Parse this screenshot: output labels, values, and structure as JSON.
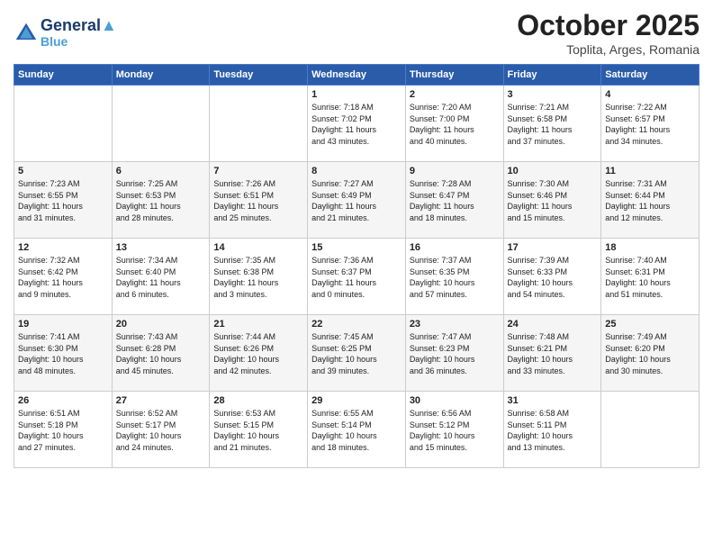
{
  "header": {
    "logo_line1": "General",
    "logo_line2": "Blue",
    "month": "October 2025",
    "location": "Toplita, Arges, Romania"
  },
  "days_of_week": [
    "Sunday",
    "Monday",
    "Tuesday",
    "Wednesday",
    "Thursday",
    "Friday",
    "Saturday"
  ],
  "rows": [
    {
      "alt": false,
      "cells": [
        {
          "day": "",
          "text": ""
        },
        {
          "day": "",
          "text": ""
        },
        {
          "day": "",
          "text": ""
        },
        {
          "day": "1",
          "text": "Sunrise: 7:18 AM\nSunset: 7:02 PM\nDaylight: 11 hours\nand 43 minutes."
        },
        {
          "day": "2",
          "text": "Sunrise: 7:20 AM\nSunset: 7:00 PM\nDaylight: 11 hours\nand 40 minutes."
        },
        {
          "day": "3",
          "text": "Sunrise: 7:21 AM\nSunset: 6:58 PM\nDaylight: 11 hours\nand 37 minutes."
        },
        {
          "day": "4",
          "text": "Sunrise: 7:22 AM\nSunset: 6:57 PM\nDaylight: 11 hours\nand 34 minutes."
        }
      ]
    },
    {
      "alt": true,
      "cells": [
        {
          "day": "5",
          "text": "Sunrise: 7:23 AM\nSunset: 6:55 PM\nDaylight: 11 hours\nand 31 minutes."
        },
        {
          "day": "6",
          "text": "Sunrise: 7:25 AM\nSunset: 6:53 PM\nDaylight: 11 hours\nand 28 minutes."
        },
        {
          "day": "7",
          "text": "Sunrise: 7:26 AM\nSunset: 6:51 PM\nDaylight: 11 hours\nand 25 minutes."
        },
        {
          "day": "8",
          "text": "Sunrise: 7:27 AM\nSunset: 6:49 PM\nDaylight: 11 hours\nand 21 minutes."
        },
        {
          "day": "9",
          "text": "Sunrise: 7:28 AM\nSunset: 6:47 PM\nDaylight: 11 hours\nand 18 minutes."
        },
        {
          "day": "10",
          "text": "Sunrise: 7:30 AM\nSunset: 6:46 PM\nDaylight: 11 hours\nand 15 minutes."
        },
        {
          "day": "11",
          "text": "Sunrise: 7:31 AM\nSunset: 6:44 PM\nDaylight: 11 hours\nand 12 minutes."
        }
      ]
    },
    {
      "alt": false,
      "cells": [
        {
          "day": "12",
          "text": "Sunrise: 7:32 AM\nSunset: 6:42 PM\nDaylight: 11 hours\nand 9 minutes."
        },
        {
          "day": "13",
          "text": "Sunrise: 7:34 AM\nSunset: 6:40 PM\nDaylight: 11 hours\nand 6 minutes."
        },
        {
          "day": "14",
          "text": "Sunrise: 7:35 AM\nSunset: 6:38 PM\nDaylight: 11 hours\nand 3 minutes."
        },
        {
          "day": "15",
          "text": "Sunrise: 7:36 AM\nSunset: 6:37 PM\nDaylight: 11 hours\nand 0 minutes."
        },
        {
          "day": "16",
          "text": "Sunrise: 7:37 AM\nSunset: 6:35 PM\nDaylight: 10 hours\nand 57 minutes."
        },
        {
          "day": "17",
          "text": "Sunrise: 7:39 AM\nSunset: 6:33 PM\nDaylight: 10 hours\nand 54 minutes."
        },
        {
          "day": "18",
          "text": "Sunrise: 7:40 AM\nSunset: 6:31 PM\nDaylight: 10 hours\nand 51 minutes."
        }
      ]
    },
    {
      "alt": true,
      "cells": [
        {
          "day": "19",
          "text": "Sunrise: 7:41 AM\nSunset: 6:30 PM\nDaylight: 10 hours\nand 48 minutes."
        },
        {
          "day": "20",
          "text": "Sunrise: 7:43 AM\nSunset: 6:28 PM\nDaylight: 10 hours\nand 45 minutes."
        },
        {
          "day": "21",
          "text": "Sunrise: 7:44 AM\nSunset: 6:26 PM\nDaylight: 10 hours\nand 42 minutes."
        },
        {
          "day": "22",
          "text": "Sunrise: 7:45 AM\nSunset: 6:25 PM\nDaylight: 10 hours\nand 39 minutes."
        },
        {
          "day": "23",
          "text": "Sunrise: 7:47 AM\nSunset: 6:23 PM\nDaylight: 10 hours\nand 36 minutes."
        },
        {
          "day": "24",
          "text": "Sunrise: 7:48 AM\nSunset: 6:21 PM\nDaylight: 10 hours\nand 33 minutes."
        },
        {
          "day": "25",
          "text": "Sunrise: 7:49 AM\nSunset: 6:20 PM\nDaylight: 10 hours\nand 30 minutes."
        }
      ]
    },
    {
      "alt": false,
      "cells": [
        {
          "day": "26",
          "text": "Sunrise: 6:51 AM\nSunset: 5:18 PM\nDaylight: 10 hours\nand 27 minutes."
        },
        {
          "day": "27",
          "text": "Sunrise: 6:52 AM\nSunset: 5:17 PM\nDaylight: 10 hours\nand 24 minutes."
        },
        {
          "day": "28",
          "text": "Sunrise: 6:53 AM\nSunset: 5:15 PM\nDaylight: 10 hours\nand 21 minutes."
        },
        {
          "day": "29",
          "text": "Sunrise: 6:55 AM\nSunset: 5:14 PM\nDaylight: 10 hours\nand 18 minutes."
        },
        {
          "day": "30",
          "text": "Sunrise: 6:56 AM\nSunset: 5:12 PM\nDaylight: 10 hours\nand 15 minutes."
        },
        {
          "day": "31",
          "text": "Sunrise: 6:58 AM\nSunset: 5:11 PM\nDaylight: 10 hours\nand 13 minutes."
        },
        {
          "day": "",
          "text": ""
        }
      ]
    }
  ]
}
